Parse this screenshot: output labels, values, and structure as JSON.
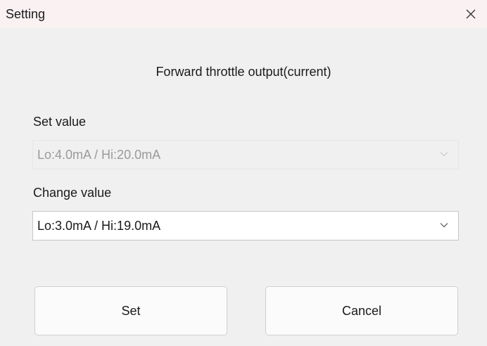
{
  "window": {
    "title": "Setting",
    "close_icon": "close-icon"
  },
  "dialog": {
    "heading": "Forward throttle output(current)",
    "set_value_label": "Set value",
    "set_value_selected": "Lo:4.0mA / Hi:20.0mA",
    "change_value_label": "Change value",
    "change_value_selected": "Lo:3.0mA / Hi:19.0mA",
    "dropdown_icon": "chevron-down-icon"
  },
  "buttons": {
    "set_label": "Set",
    "cancel_label": "Cancel"
  },
  "colors": {
    "titlebar_bg": "#faf1f3",
    "window_bg": "#f0f0f0",
    "disabled_text": "#9a9a9a"
  }
}
